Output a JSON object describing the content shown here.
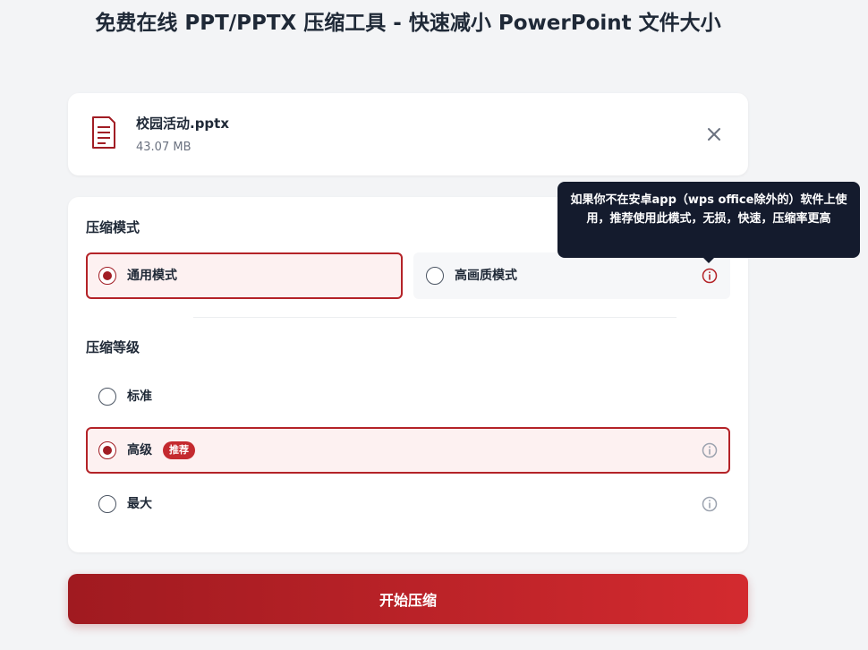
{
  "page": {
    "title": "免费在线 PPT/PPTX 压缩工具 - 快速减小 PowerPoint 文件大小"
  },
  "file": {
    "name": "校园活动.pptx",
    "size": "43.07 MB",
    "icon": "document-icon",
    "remove_icon": "close-icon"
  },
  "compression_mode": {
    "label": "压缩模式",
    "options": [
      {
        "label": "通用模式",
        "selected": true
      },
      {
        "label": "高画质模式",
        "selected": false,
        "info_icon": "info-icon"
      }
    ],
    "tooltip": "如果你不在安卓app（wps office除外的）软件上使用，推荐使用此模式，无损，快速，压缩率更高"
  },
  "compression_level": {
    "label": "压缩等级",
    "options": [
      {
        "label": "标准",
        "selected": false
      },
      {
        "label": "高级",
        "selected": true,
        "badge": "推荐",
        "info_icon": "info-icon"
      },
      {
        "label": "最大",
        "selected": false,
        "info_icon": "info-icon"
      }
    ]
  },
  "actions": {
    "start_label": "开始压缩"
  },
  "colors": {
    "accent": "#a11d24",
    "selected_bg": "#fdf1f1",
    "tooltip_bg": "#141b2d",
    "page_bg": "#f3f4f6"
  }
}
